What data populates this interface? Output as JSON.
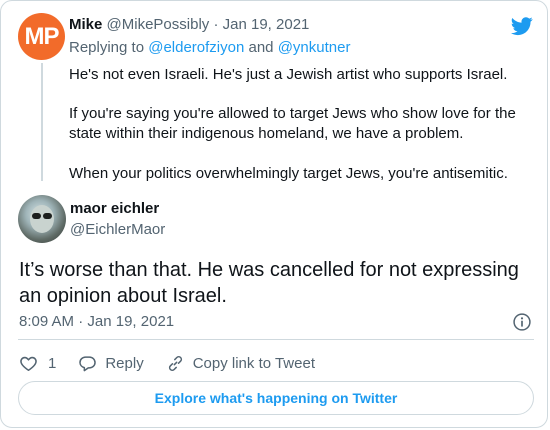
{
  "parent_tweet": {
    "avatar_initials": "MP",
    "display_name": "Mike",
    "handle": "@MikePossibly",
    "separator": "·",
    "date": "Jan 19, 2021",
    "replying_prefix": "Replying to",
    "replying_user1": "@elderofziyon",
    "replying_and": "and",
    "replying_user2": "@ynkutner",
    "paragraphs": [
      "He's not even Israeli. He's just a Jewish artist who supports Israel.",
      "If you're saying you're allowed to target Jews who show love for the state within their indigenous homeland, we have a problem.",
      "When your politics overwhelmingly target Jews, you're antisemitic."
    ]
  },
  "main_tweet": {
    "display_name": "maor eichler",
    "handle": "@EichlerMaor",
    "text": "It’s worse than that. He was cancelled for not expressing an opinion about Israel.",
    "time": "8:09 AM",
    "separator": "·",
    "date": "Jan 19, 2021"
  },
  "actions": {
    "like_count": "1",
    "reply_label": "Reply",
    "copy_link_label": "Copy link to Tweet"
  },
  "explore_label": "Explore what's happening on Twitter",
  "colors": {
    "accent": "#1d9bf0",
    "muted_text": "#536471",
    "border": "#cfd9de",
    "avatar_mp": "#f26b2a"
  },
  "icons": [
    "twitter-bird-icon",
    "info-icon",
    "heart-icon",
    "reply-icon",
    "link-icon"
  ]
}
